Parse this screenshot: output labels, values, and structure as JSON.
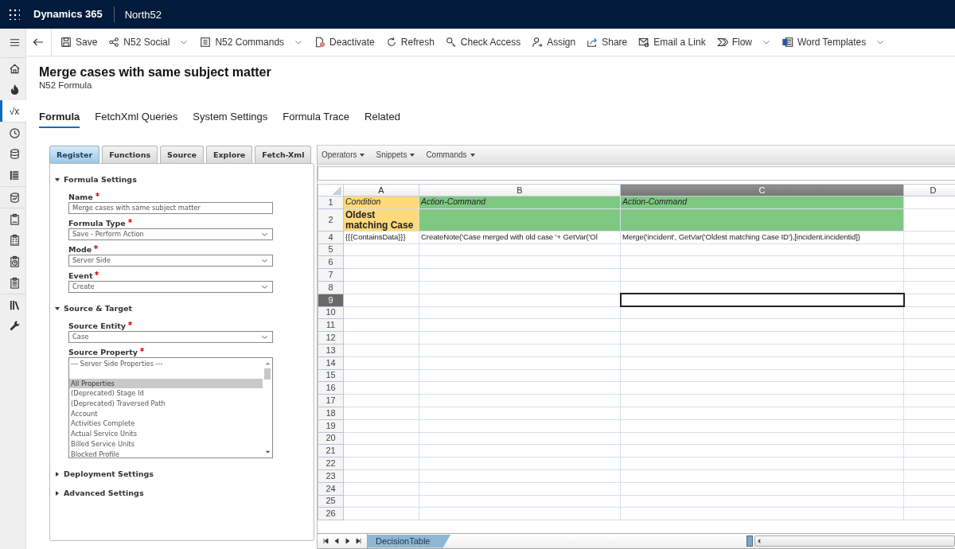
{
  "app": {
    "name": "Dynamics 365",
    "area": "North52"
  },
  "rail": [
    {
      "kind": "menu",
      "selected": false
    },
    {
      "kind": "home",
      "selected": false
    },
    {
      "kind": "fire",
      "selected": false
    },
    {
      "kind": "glyph",
      "text": "√x",
      "selected": true
    },
    {
      "kind": "clock",
      "selected": false
    },
    {
      "kind": "database",
      "selected": false
    },
    {
      "kind": "list",
      "selected": false
    },
    {
      "kind": "database-chart",
      "selected": false
    },
    {
      "kind": "clipboard",
      "selected": false
    },
    {
      "kind": "clipboard-grid",
      "selected": false
    },
    {
      "kind": "clipboard-clock",
      "selected": false
    },
    {
      "kind": "clipboard-list",
      "selected": false
    },
    {
      "kind": "books",
      "selected": false
    },
    {
      "kind": "wrench",
      "selected": false
    }
  ],
  "commands": [
    {
      "kind": "back",
      "dropdown": false
    },
    {
      "kind": "save",
      "label": "Save",
      "dropdown": false
    },
    {
      "kind": "social",
      "label": "N52 Social",
      "dropdown": true
    },
    {
      "kind": "document",
      "label": "N52 Commands",
      "dropdown": true
    },
    {
      "kind": "deactivate",
      "label": "Deactivate",
      "dropdown": false
    },
    {
      "kind": "refresh",
      "label": "Refresh",
      "dropdown": false
    },
    {
      "kind": "key",
      "label": "Check Access",
      "dropdown": false
    },
    {
      "kind": "person",
      "label": "Assign",
      "dropdown": false
    },
    {
      "kind": "share",
      "label": "Share",
      "dropdown": false
    },
    {
      "kind": "email",
      "label": "Email a Link",
      "dropdown": false
    },
    {
      "kind": "flow",
      "label": "Flow",
      "dropdown": true
    },
    {
      "kind": "word",
      "label": "Word Templates",
      "dropdown": true
    }
  ],
  "record": {
    "title": "Merge cases with same subject matter",
    "subtitle": "N52 Formula"
  },
  "tabs": [
    {
      "label": "Formula",
      "selected": true
    },
    {
      "label": "FetchXml Queries",
      "selected": false
    },
    {
      "label": "System Settings",
      "selected": false
    },
    {
      "label": "Formula Trace",
      "selected": false
    },
    {
      "label": "Related",
      "selected": false
    }
  ],
  "form_panel": {
    "tabs": [
      {
        "label": "Register",
        "selected": true
      },
      {
        "label": "Functions",
        "selected": false
      },
      {
        "label": "Source",
        "selected": false
      },
      {
        "label": "Explore",
        "selected": false
      },
      {
        "label": "Fetch-Xml",
        "selected": false
      }
    ],
    "sections": [
      {
        "title": "Formula Settings",
        "expanded": true,
        "fields": [
          {
            "kind": "text",
            "label": "Name",
            "required": true,
            "value": "Merge cases with same subject matter"
          },
          {
            "kind": "select",
            "label": "Formula Type",
            "required": true,
            "value": "Save - Perform Action"
          },
          {
            "kind": "select",
            "label": "Mode",
            "required": true,
            "value": "Server Side"
          },
          {
            "kind": "select",
            "label": "Event",
            "required": true,
            "value": "Create"
          }
        ]
      },
      {
        "title": "Source & Target",
        "expanded": true,
        "fields": [
          {
            "kind": "select",
            "label": "Source Entity",
            "required": true,
            "value": "Case"
          },
          {
            "kind": "listbox",
            "label": "Source Property",
            "required": true,
            "options": [
              {
                "kind": "group",
                "label": "--- Server Side Properties ---",
                "selected": false
              },
              {
                "kind": "item",
                "label": "All Properties",
                "selected": true
              },
              {
                "kind": "item",
                "label": "(Deprecated) Stage Id",
                "selected": false
              },
              {
                "kind": "item",
                "label": "(Deprecated) Traversed Path",
                "selected": false
              },
              {
                "kind": "item",
                "label": "Account",
                "selected": false
              },
              {
                "kind": "item",
                "label": "Activities Complete",
                "selected": false
              },
              {
                "kind": "item",
                "label": "Actual Service Units",
                "selected": false
              },
              {
                "kind": "item",
                "label": "Billed Service Units",
                "selected": false
              },
              {
                "kind": "item",
                "label": "Blocked Profile",
                "selected": false
              }
            ]
          }
        ]
      },
      {
        "title": "Deployment Settings",
        "expanded": false
      },
      {
        "title": "Advanced Settings",
        "expanded": false
      }
    ]
  },
  "sheet": {
    "menus": [
      "Operators",
      "Snippets",
      "Commands"
    ],
    "columns": [
      {
        "label": "A",
        "selected": false
      },
      {
        "label": "B",
        "selected": false
      },
      {
        "label": "C",
        "selected": true
      },
      {
        "label": "D",
        "selected": false
      }
    ],
    "rows": [
      {
        "number": "1",
        "selected": false,
        "cells": [
          {
            "kind": "label",
            "text": "Condition",
            "color": "#ffd97a"
          },
          {
            "kind": "label",
            "text": "Action-Command",
            "color": "#7ec882"
          },
          {
            "kind": "label",
            "text": "Action-Command",
            "color": "#7ec882"
          }
        ]
      },
      {
        "number": "2",
        "selected": false,
        "cells": [
          {
            "kind": "heading",
            "text": "Oldest matching Case",
            "color": "#ffd97a"
          },
          {
            "kind": "blank",
            "color": "#7ec882"
          },
          {
            "kind": "blank",
            "color": "#7ec882"
          }
        ]
      },
      {
        "number": "4",
        "selected": false,
        "cells": [
          {
            "kind": "value",
            "text": "{{{ContainsData}}}"
          },
          {
            "kind": "value",
            "text": "CreateNote('Case merged with old case '+ GetVar('Ol"
          },
          {
            "kind": "value",
            "text": "Merge('incident', GetVar('Oldest matching Case ID'),[incident.incidentid])"
          }
        ]
      },
      {
        "number": "5",
        "selected": false
      },
      {
        "number": "6",
        "selected": false
      },
      {
        "number": "7",
        "selected": false
      },
      {
        "number": "8",
        "selected": false
      },
      {
        "number": "9",
        "selected": true
      },
      {
        "number": "10",
        "selected": false
      },
      {
        "number": "11",
        "selected": false
      },
      {
        "number": "12",
        "selected": false
      },
      {
        "number": "13",
        "selected": false
      },
      {
        "number": "14",
        "selected": false
      },
      {
        "number": "15",
        "selected": false
      },
      {
        "number": "16",
        "selected": false
      },
      {
        "number": "17",
        "selected": false
      },
      {
        "number": "18",
        "selected": false
      },
      {
        "number": "19",
        "selected": false
      },
      {
        "number": "20",
        "selected": false
      },
      {
        "number": "21",
        "selected": false
      },
      {
        "number": "22",
        "selected": false
      },
      {
        "number": "23",
        "selected": false
      },
      {
        "number": "24",
        "selected": false
      },
      {
        "number": "25",
        "selected": false
      },
      {
        "number": "26",
        "selected": false
      }
    ],
    "sheet_tabs": [
      {
        "label": "DecisionTable",
        "selected": true
      }
    ]
  }
}
